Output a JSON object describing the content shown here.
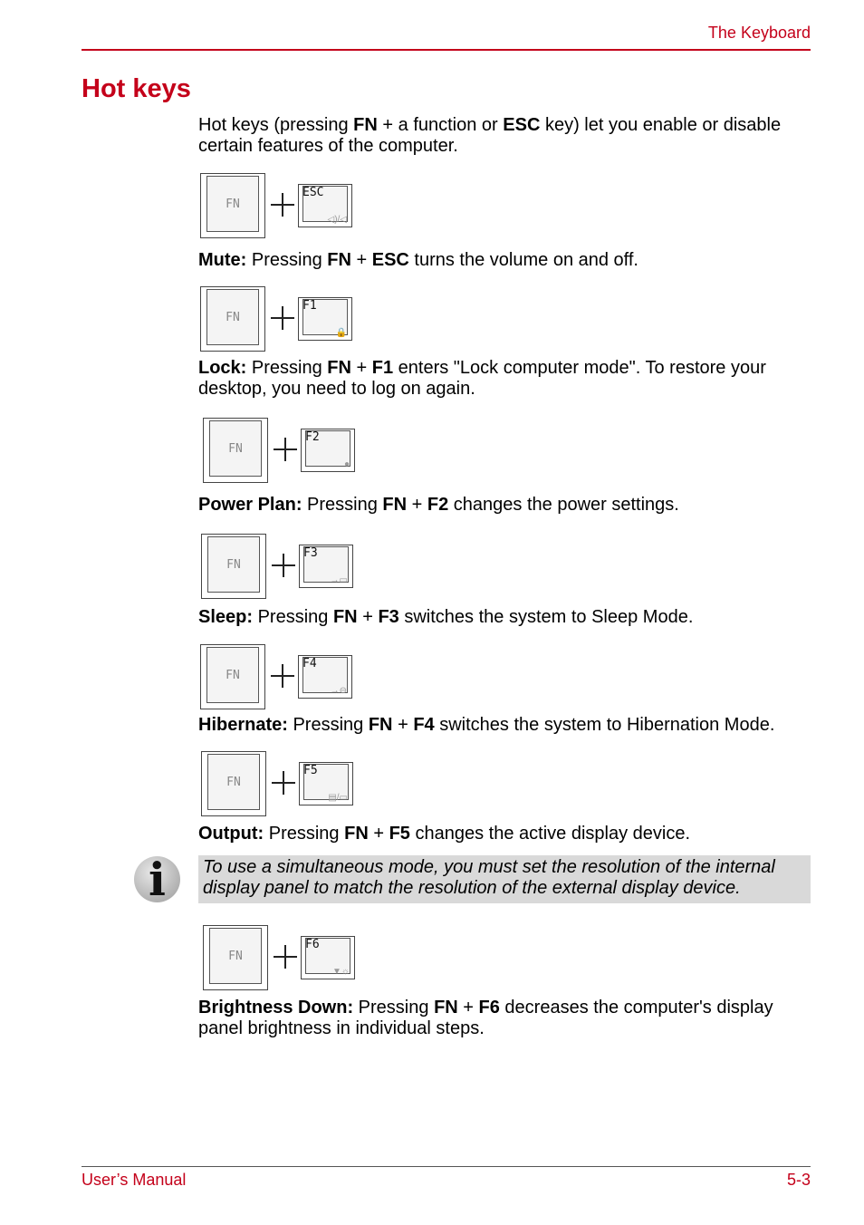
{
  "header": {
    "section": "The Keyboard"
  },
  "title": "Hot keys",
  "intro": [
    {
      "t": "Hot keys (pressing "
    },
    {
      "b": "FN"
    },
    {
      "t": " + a function or "
    },
    {
      "b": "ESC"
    },
    {
      "t": " key) let you enable or disable certain features of the computer."
    }
  ],
  "plus_symbol": "+",
  "fn_label": "FN",
  "items": [
    {
      "key": "ESC",
      "icon": "speaker-mute-icon",
      "glyph": "◁)/◁",
      "desc": [
        {
          "b": "Mute:"
        },
        {
          "t": " Pressing "
        },
        {
          "b": "FN"
        },
        {
          "t": " + "
        },
        {
          "b": "ESC"
        },
        {
          "t": " turns the volume on and off."
        }
      ]
    },
    {
      "key": "F1",
      "icon": "lock-icon",
      "glyph": "🔒",
      "desc": [
        {
          "b": "Lock:"
        },
        {
          "t": " Pressing "
        },
        {
          "b": "FN"
        },
        {
          "t": " + "
        },
        {
          "b": "F1"
        },
        {
          "t": " enters \"Lock computer mode\". To restore your desktop, you need to log on again."
        }
      ]
    },
    {
      "key": "F2",
      "icon": "power-plan-icon",
      "glyph": "●",
      "desc": [
        {
          "b": "Power Plan:"
        },
        {
          "t": " Pressing "
        },
        {
          "b": "FN"
        },
        {
          "t": " + "
        },
        {
          "b": "F2"
        },
        {
          "t": " changes the power settings."
        }
      ]
    },
    {
      "key": "F3",
      "icon": "sleep-icon",
      "glyph": "→▭",
      "desc": [
        {
          "b": "Sleep:"
        },
        {
          "t": " Pressing "
        },
        {
          "b": "FN"
        },
        {
          "t": " + "
        },
        {
          "b": "F3"
        },
        {
          "t": " switches the system to Sleep Mode."
        }
      ]
    },
    {
      "key": "F4",
      "icon": "hibernate-icon",
      "glyph": "→⊖",
      "desc": [
        {
          "b": "Hibernate:"
        },
        {
          "t": " Pressing "
        },
        {
          "b": "FN"
        },
        {
          "t": " + "
        },
        {
          "b": "F4"
        },
        {
          "t": " switches the system to Hibernation Mode."
        }
      ]
    },
    {
      "key": "F5",
      "icon": "display-output-icon",
      "glyph": "▤/▭",
      "desc": [
        {
          "b": "Output:"
        },
        {
          "t": " Pressing "
        },
        {
          "b": "FN"
        },
        {
          "t": " + "
        },
        {
          "b": "F5"
        },
        {
          "t": " changes the active display device."
        }
      ]
    },
    {
      "key": "F6",
      "icon": "brightness-down-icon",
      "glyph": "▼☼",
      "desc": [
        {
          "b": "Brightness Down:"
        },
        {
          "t": " Pressing "
        },
        {
          "b": "FN"
        },
        {
          "t": " + "
        },
        {
          "b": "F6"
        },
        {
          "t": " decreases the computer's display panel brightness in individual steps."
        }
      ]
    }
  ],
  "note": {
    "icon": "info-icon",
    "glyph": "i",
    "text": "To use a simultaneous mode, you must set the resolution of the internal display panel to match the resolution of the external display device."
  },
  "footer": {
    "left": "User’s Manual",
    "right": "5-3"
  },
  "colors": {
    "accent": "#c4001a",
    "note_bg": "#d9d9d9"
  }
}
